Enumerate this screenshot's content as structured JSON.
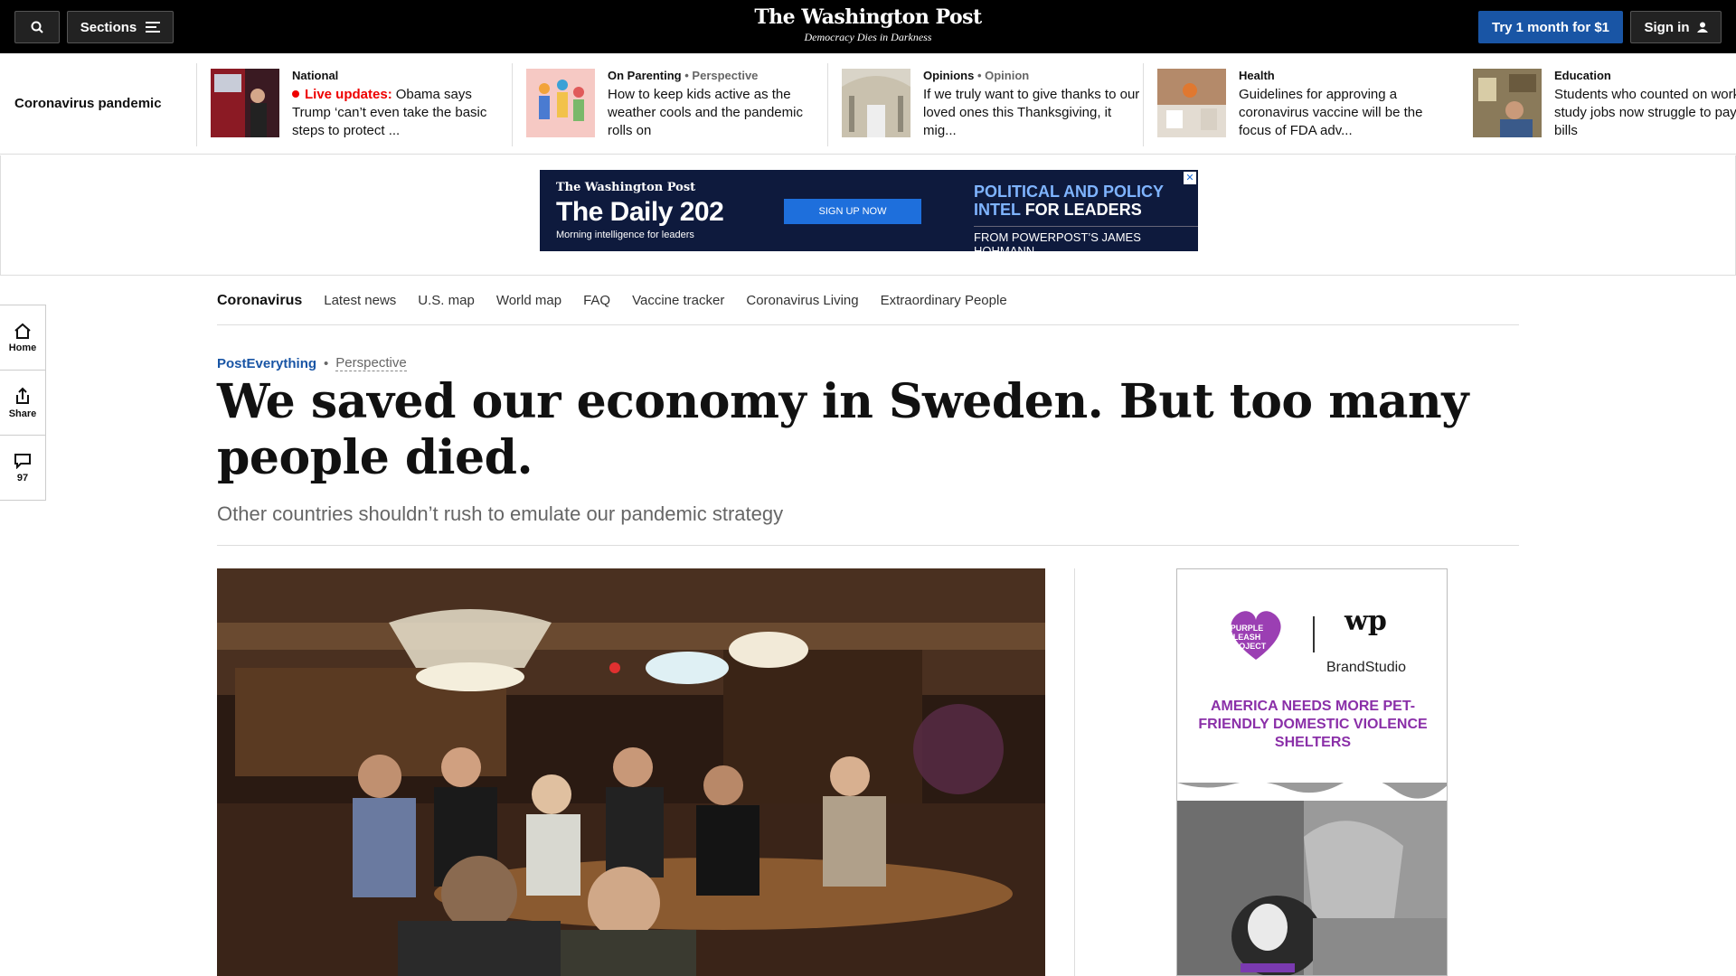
{
  "topbar": {
    "sections_label": "Sections",
    "logo_name": "The Washington Post",
    "logo_tagline": "Democracy Dies in Darkness",
    "trial_label": "Try 1 month for $1",
    "signin_label": "Sign in"
  },
  "strip": {
    "label": "Coronavirus pandemic",
    "stories": [
      {
        "kicker": "National",
        "kicker_sub": "",
        "live_label": "Live updates:",
        "headline": "Obama says Trump ‘can’t even take the basic steps to protect ..."
      },
      {
        "kicker": "On Parenting",
        "kicker_sub": "• Perspective",
        "live_label": "",
        "headline": "How to keep kids active as the weather cools and the pandemic rolls on"
      },
      {
        "kicker": "Opinions",
        "kicker_sub": "• Opinion",
        "live_label": "",
        "headline": "If we truly want to give thanks to our loved ones this Thanksgiving, it mig..."
      },
      {
        "kicker": "Health",
        "kicker_sub": "",
        "live_label": "",
        "headline": "Guidelines for approving a coronavirus vaccine will be the focus of FDA adv..."
      },
      {
        "kicker": "Education",
        "kicker_sub": "",
        "live_label": "",
        "headline": "Students who counted on work-study jobs now struggle to pay their bills"
      }
    ]
  },
  "ad_banner": {
    "brand": "The Washington Post",
    "title": "The Daily 202",
    "subtitle": "Morning intelligence for leaders",
    "cta": "SIGN UP NOW",
    "line1": "POLITICAL AND POLICY",
    "line2a": "INTEL",
    "line2b": "FOR LEADERS",
    "from": "FROM POWERPOST’S JAMES HOHMANN",
    "close": "✕"
  },
  "subnav": {
    "title": "Coronavirus",
    "items": [
      "Latest news",
      "U.S. map",
      "World map",
      "FAQ",
      "Vaccine tracker",
      "Coronavirus Living",
      "Extraordinary People"
    ]
  },
  "rail": {
    "home_label": "Home",
    "share_label": "Share",
    "comments_count": "97"
  },
  "article": {
    "section": "PostEverything",
    "label": "Perspective",
    "headline": "We saved our economy in Sweden. But too many people died.",
    "dek": "Other countries shouldn’t rush to emulate our pandemic strategy"
  },
  "right_ad": {
    "logo_text": "PURPLE LEASH PROJECT",
    "wp_mark": "wp",
    "brand": "BrandStudio",
    "message": "AMERICA NEEDS MORE PET-FRIENDLY DOMESTIC VIOLENCE SHELTERS"
  },
  "colors": {
    "accent_blue": "#1955a5",
    "live_red": "#e00000",
    "ad_purple": "#8a2fa8"
  }
}
